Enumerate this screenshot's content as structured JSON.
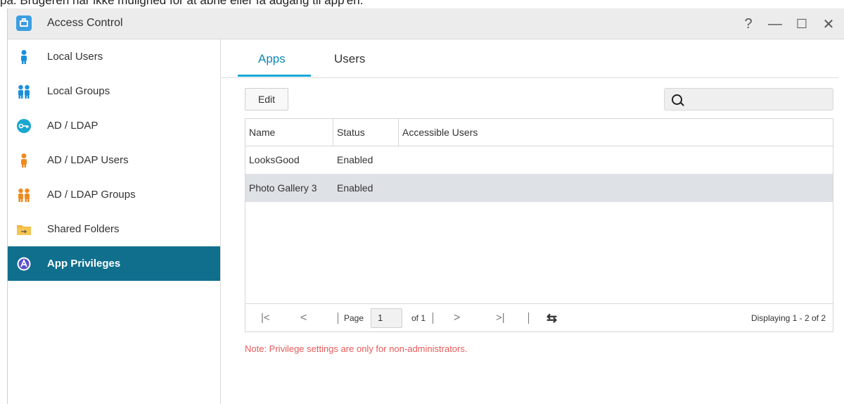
{
  "top_text": "på. Brugeren har ikke mulighed for at åbne eller få adgang til app'en.",
  "window": {
    "title": "Access Control",
    "controls": [
      "?",
      "—",
      "☐",
      "✕"
    ]
  },
  "sidebar": {
    "items": [
      {
        "label": "Local Users",
        "icon": "local-user-icon"
      },
      {
        "label": "Local Groups",
        "icon": "local-group-icon"
      },
      {
        "label": "AD / LDAP",
        "icon": "ad-ldap-key-icon"
      },
      {
        "label": "AD / LDAP Users",
        "icon": "ad-ldap-user-icon"
      },
      {
        "label": "AD / LDAP Groups",
        "icon": "ad-ldap-group-icon"
      },
      {
        "label": "Shared Folders",
        "icon": "shared-folder-icon"
      },
      {
        "label": "App Privileges",
        "icon": "app-privileges-icon",
        "active": true
      }
    ]
  },
  "tabs": [
    {
      "label": "Apps",
      "active": true
    },
    {
      "label": "Users",
      "active": false
    }
  ],
  "toolbar": {
    "edit_label": "Edit",
    "search_value": ""
  },
  "table": {
    "columns": [
      "Name",
      "Status",
      "Accessible Users"
    ],
    "rows": [
      {
        "name": "LooksGood",
        "status": "Enabled",
        "users": "",
        "selected": false
      },
      {
        "name": "Photo Gallery 3",
        "status": "Enabled",
        "users": "",
        "selected": true
      }
    ]
  },
  "pager": {
    "first": "|<",
    "prev": "<",
    "page_label": "Page",
    "page_value": "1",
    "of_label": "of 1",
    "next": ">",
    "last": ">|",
    "refresh": "⇆",
    "displaying": "Displaying 1 - 2 of 2"
  },
  "note": "Note: Privilege settings are only for non-administrators.",
  "colors": {
    "accent": "#0f6f8d",
    "tab_active": "#18a8d8",
    "note": "#e55a5a"
  }
}
